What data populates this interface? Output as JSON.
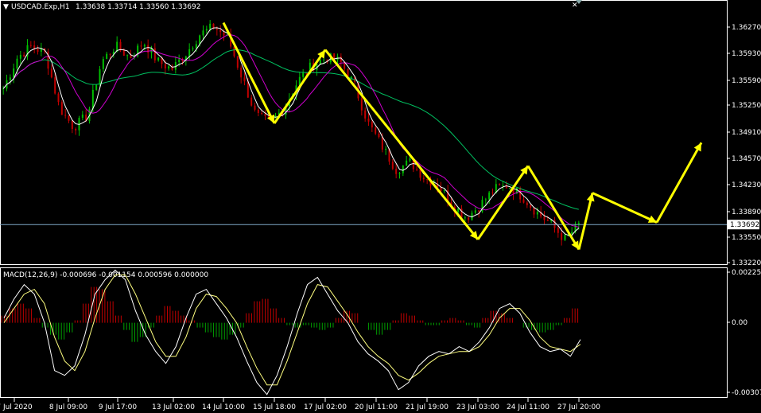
{
  "header": {
    "symbol": "USDCAD.Exp,H1",
    "ohlc": "1.33638 1.33714 1.33560 1.33692"
  },
  "macd_header": "MACD(12,26,9) -0.000696 -0.001154 0.000596 0.000000",
  "colors": {
    "background": "#000000",
    "grid_border": "#ffffff",
    "bull_candle": "#00c000",
    "bear_candle": "#c00000",
    "ma_fast": "#ffffff",
    "ma_mid": "#d000d0",
    "ma_slow": "#00c060",
    "arrows": "#ffff00",
    "price_line": "#7fa8c8",
    "hist_pos": "#c00000",
    "hist_neg": "#00a000",
    "macd_line": "#ffffff",
    "signal_line": "#ffff80"
  },
  "chart_data": [
    {
      "type": "line",
      "panel": "price",
      "title": "USDCAD.Exp,H1",
      "y_ticks": [
        "1.36270",
        "1.35930",
        "1.35590",
        "1.35250",
        "1.34910",
        "1.34570",
        "1.34230",
        "1.33890",
        "1.33550",
        "1.33220"
      ],
      "current_price": "1.33692",
      "ylim": [
        1.3318,
        1.3647
      ],
      "x_ticks": [
        "7 Jul 2020",
        "8 Jul 09:00",
        "9 Jul 17:00",
        "13 Jul 02:00",
        "14 Jul 10:00",
        "15 Jul 18:00",
        "17 Jul 02:00",
        "20 Jul 11:00",
        "21 Jul 19:00",
        "23 Jul 03:00",
        "24 Jul 11:00",
        "27 Jul 20:00"
      ],
      "price_path": [
        1.3545,
        1.3585,
        1.36,
        1.359,
        1.352,
        1.3495,
        1.351,
        1.358,
        1.36,
        1.3585,
        1.3605,
        1.358,
        1.357,
        1.359,
        1.3615,
        1.3625,
        1.361,
        1.356,
        1.351,
        1.35,
        1.352,
        1.3555,
        1.3575,
        1.3585,
        1.358,
        1.355,
        1.35,
        1.347,
        1.344,
        1.345,
        1.343,
        1.342,
        1.3395,
        1.3378,
        1.3395,
        1.3415,
        1.342,
        1.3405,
        1.3385,
        1.337,
        1.335,
        1.3369
      ],
      "zigzag": [
        {
          "x": "14 Jul 10:00",
          "y": 1.363
        },
        {
          "x": "15 Jul 18:00",
          "y": 1.35
        },
        {
          "x": "17 Jul 02:00",
          "y": 1.3595
        },
        {
          "x": "23 Jul 03:00",
          "y": 1.335
        },
        {
          "x": "24 Jul 11:00",
          "y": 1.3445
        },
        {
          "x": "27 Jul 20:00",
          "y": 1.3337
        }
      ],
      "projection": [
        {
          "x": "27 Jul 20:00",
          "y": 1.3337
        },
        {
          "y": 1.341
        },
        {
          "y": 1.3372
        },
        {
          "y": 1.3475
        }
      ]
    },
    {
      "type": "bar",
      "panel": "macd",
      "title": "MACD(12,26,9)",
      "y_ticks": [
        "0.002251",
        "0.00",
        "-0.003076"
      ],
      "ylim": [
        -0.003076,
        0.002251
      ],
      "histogram": [
        0.0003,
        0.0006,
        0.0008,
        0.0006,
        0.0002,
        -0.0002,
        -0.0005,
        -0.0007,
        -0.0004,
        0.0001,
        0.0008,
        0.0015,
        0.0014,
        0.0009,
        0.0003,
        -0.0003,
        -0.0008,
        -0.0006,
        -0.0002,
        0.0003,
        0.0007,
        0.0005,
        0.0003,
        0.0001,
        -0.0002,
        -0.0004,
        -0.0006,
        -0.0007,
        -0.0005,
        -0.0002,
        0.0004,
        0.0009,
        0.001,
        0.0006,
        0.0002,
        -0.0001,
        -0.0002,
        -0.0001,
        -0.0002,
        -0.0003,
        -0.0002,
        0.0002,
        0.0005,
        0.0004,
        0.0,
        -0.0003,
        -0.0005,
        -0.0003,
        0.0001,
        0.0004,
        0.0003,
        0.0001,
        -0.0001,
        -0.0001,
        0.0001,
        0.0002,
        0.0001,
        -0.0001,
        -0.0002,
        0.0002,
        0.0005,
        0.0004,
        0.0002,
        0.0,
        -0.0002,
        -0.0003,
        -0.0004,
        -0.0003,
        -0.0001,
        0.0002,
        0.0006
      ],
      "macd": [
        0.0002,
        0.001,
        0.0016,
        0.0012,
        0.0,
        -0.002,
        -0.0022,
        -0.0018,
        -0.0005,
        0.0012,
        0.0018,
        0.0022,
        0.0018,
        0.0005,
        -0.0005,
        -0.0012,
        -0.0017,
        -0.001,
        0.0002,
        0.0012,
        0.0014,
        0.0008,
        0.0002,
        -0.0006,
        -0.0016,
        -0.0025,
        -0.003,
        -0.0022,
        -0.001,
        0.0004,
        0.0016,
        0.0019,
        0.0012,
        0.0005,
        0.0,
        -0.0008,
        -0.0013,
        -0.0016,
        -0.002,
        -0.0028,
        -0.0025,
        -0.0018,
        -0.0014,
        -0.0012,
        -0.0013,
        -0.001,
        -0.0012,
        -0.0008,
        -0.0002,
        0.0006,
        0.0008,
        0.0004,
        -0.0004,
        -0.001,
        -0.0012,
        -0.0011,
        -0.0014,
        -0.0007
      ],
      "signal": [
        0.0,
        0.0006,
        0.0012,
        0.0014,
        0.0008,
        -0.0006,
        -0.0016,
        -0.002,
        -0.0012,
        0.0002,
        0.0014,
        0.002,
        0.002,
        0.0012,
        0.0002,
        -0.0008,
        -0.0014,
        -0.0014,
        -0.0006,
        0.0006,
        0.0012,
        0.0011,
        0.0006,
        0.0,
        -0.001,
        -0.0019,
        -0.0026,
        -0.0026,
        -0.0016,
        -0.0004,
        0.0008,
        0.0016,
        0.0015,
        0.0009,
        0.0003,
        -0.0004,
        -0.001,
        -0.0014,
        -0.0017,
        -0.0022,
        -0.0024,
        -0.0021,
        -0.0017,
        -0.0014,
        -0.0013,
        -0.0012,
        -0.0012,
        -0.001,
        -0.0005,
        0.0002,
        0.0006,
        0.0006,
        0.0001,
        -0.0006,
        -0.001,
        -0.0011,
        -0.0012,
        -0.0009
      ]
    }
  ]
}
